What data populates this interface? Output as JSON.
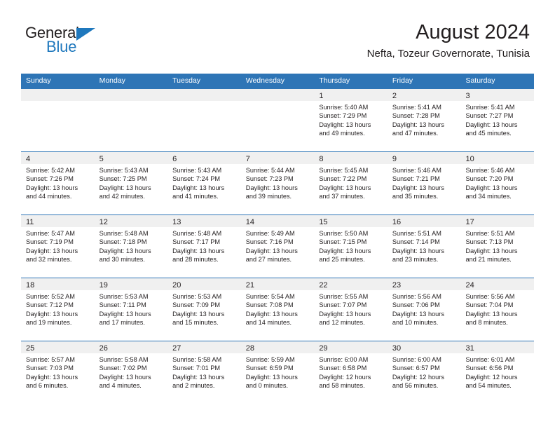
{
  "brand": {
    "name_top": "General",
    "name_bottom": "Blue",
    "accent_color": "#1f78bd"
  },
  "header": {
    "title": "August 2024",
    "subtitle": "Nefta, Tozeur Governorate, Tunisia"
  },
  "theme": {
    "header_row_bg": "#2e75b6",
    "daynum_band_bg": "#f0f0f0",
    "grid_line": "#2e75b6",
    "text": "#231f20"
  },
  "weekdays": [
    "Sunday",
    "Monday",
    "Tuesday",
    "Wednesday",
    "Thursday",
    "Friday",
    "Saturday"
  ],
  "weeks": [
    [
      {
        "day": "",
        "sunrise": "",
        "sunset": "",
        "daylight_1": "",
        "daylight_2": ""
      },
      {
        "day": "",
        "sunrise": "",
        "sunset": "",
        "daylight_1": "",
        "daylight_2": ""
      },
      {
        "day": "",
        "sunrise": "",
        "sunset": "",
        "daylight_1": "",
        "daylight_2": ""
      },
      {
        "day": "",
        "sunrise": "",
        "sunset": "",
        "daylight_1": "",
        "daylight_2": ""
      },
      {
        "day": "1",
        "sunrise": "Sunrise: 5:40 AM",
        "sunset": "Sunset: 7:29 PM",
        "daylight_1": "Daylight: 13 hours",
        "daylight_2": "and 49 minutes."
      },
      {
        "day": "2",
        "sunrise": "Sunrise: 5:41 AM",
        "sunset": "Sunset: 7:28 PM",
        "daylight_1": "Daylight: 13 hours",
        "daylight_2": "and 47 minutes."
      },
      {
        "day": "3",
        "sunrise": "Sunrise: 5:41 AM",
        "sunset": "Sunset: 7:27 PM",
        "daylight_1": "Daylight: 13 hours",
        "daylight_2": "and 45 minutes."
      }
    ],
    [
      {
        "day": "4",
        "sunrise": "Sunrise: 5:42 AM",
        "sunset": "Sunset: 7:26 PM",
        "daylight_1": "Daylight: 13 hours",
        "daylight_2": "and 44 minutes."
      },
      {
        "day": "5",
        "sunrise": "Sunrise: 5:43 AM",
        "sunset": "Sunset: 7:25 PM",
        "daylight_1": "Daylight: 13 hours",
        "daylight_2": "and 42 minutes."
      },
      {
        "day": "6",
        "sunrise": "Sunrise: 5:43 AM",
        "sunset": "Sunset: 7:24 PM",
        "daylight_1": "Daylight: 13 hours",
        "daylight_2": "and 41 minutes."
      },
      {
        "day": "7",
        "sunrise": "Sunrise: 5:44 AM",
        "sunset": "Sunset: 7:23 PM",
        "daylight_1": "Daylight: 13 hours",
        "daylight_2": "and 39 minutes."
      },
      {
        "day": "8",
        "sunrise": "Sunrise: 5:45 AM",
        "sunset": "Sunset: 7:22 PM",
        "daylight_1": "Daylight: 13 hours",
        "daylight_2": "and 37 minutes."
      },
      {
        "day": "9",
        "sunrise": "Sunrise: 5:46 AM",
        "sunset": "Sunset: 7:21 PM",
        "daylight_1": "Daylight: 13 hours",
        "daylight_2": "and 35 minutes."
      },
      {
        "day": "10",
        "sunrise": "Sunrise: 5:46 AM",
        "sunset": "Sunset: 7:20 PM",
        "daylight_1": "Daylight: 13 hours",
        "daylight_2": "and 34 minutes."
      }
    ],
    [
      {
        "day": "11",
        "sunrise": "Sunrise: 5:47 AM",
        "sunset": "Sunset: 7:19 PM",
        "daylight_1": "Daylight: 13 hours",
        "daylight_2": "and 32 minutes."
      },
      {
        "day": "12",
        "sunrise": "Sunrise: 5:48 AM",
        "sunset": "Sunset: 7:18 PM",
        "daylight_1": "Daylight: 13 hours",
        "daylight_2": "and 30 minutes."
      },
      {
        "day": "13",
        "sunrise": "Sunrise: 5:48 AM",
        "sunset": "Sunset: 7:17 PM",
        "daylight_1": "Daylight: 13 hours",
        "daylight_2": "and 28 minutes."
      },
      {
        "day": "14",
        "sunrise": "Sunrise: 5:49 AM",
        "sunset": "Sunset: 7:16 PM",
        "daylight_1": "Daylight: 13 hours",
        "daylight_2": "and 27 minutes."
      },
      {
        "day": "15",
        "sunrise": "Sunrise: 5:50 AM",
        "sunset": "Sunset: 7:15 PM",
        "daylight_1": "Daylight: 13 hours",
        "daylight_2": "and 25 minutes."
      },
      {
        "day": "16",
        "sunrise": "Sunrise: 5:51 AM",
        "sunset": "Sunset: 7:14 PM",
        "daylight_1": "Daylight: 13 hours",
        "daylight_2": "and 23 minutes."
      },
      {
        "day": "17",
        "sunrise": "Sunrise: 5:51 AM",
        "sunset": "Sunset: 7:13 PM",
        "daylight_1": "Daylight: 13 hours",
        "daylight_2": "and 21 minutes."
      }
    ],
    [
      {
        "day": "18",
        "sunrise": "Sunrise: 5:52 AM",
        "sunset": "Sunset: 7:12 PM",
        "daylight_1": "Daylight: 13 hours",
        "daylight_2": "and 19 minutes."
      },
      {
        "day": "19",
        "sunrise": "Sunrise: 5:53 AM",
        "sunset": "Sunset: 7:11 PM",
        "daylight_1": "Daylight: 13 hours",
        "daylight_2": "and 17 minutes."
      },
      {
        "day": "20",
        "sunrise": "Sunrise: 5:53 AM",
        "sunset": "Sunset: 7:09 PM",
        "daylight_1": "Daylight: 13 hours",
        "daylight_2": "and 15 minutes."
      },
      {
        "day": "21",
        "sunrise": "Sunrise: 5:54 AM",
        "sunset": "Sunset: 7:08 PM",
        "daylight_1": "Daylight: 13 hours",
        "daylight_2": "and 14 minutes."
      },
      {
        "day": "22",
        "sunrise": "Sunrise: 5:55 AM",
        "sunset": "Sunset: 7:07 PM",
        "daylight_1": "Daylight: 13 hours",
        "daylight_2": "and 12 minutes."
      },
      {
        "day": "23",
        "sunrise": "Sunrise: 5:56 AM",
        "sunset": "Sunset: 7:06 PM",
        "daylight_1": "Daylight: 13 hours",
        "daylight_2": "and 10 minutes."
      },
      {
        "day": "24",
        "sunrise": "Sunrise: 5:56 AM",
        "sunset": "Sunset: 7:04 PM",
        "daylight_1": "Daylight: 13 hours",
        "daylight_2": "and 8 minutes."
      }
    ],
    [
      {
        "day": "25",
        "sunrise": "Sunrise: 5:57 AM",
        "sunset": "Sunset: 7:03 PM",
        "daylight_1": "Daylight: 13 hours",
        "daylight_2": "and 6 minutes."
      },
      {
        "day": "26",
        "sunrise": "Sunrise: 5:58 AM",
        "sunset": "Sunset: 7:02 PM",
        "daylight_1": "Daylight: 13 hours",
        "daylight_2": "and 4 minutes."
      },
      {
        "day": "27",
        "sunrise": "Sunrise: 5:58 AM",
        "sunset": "Sunset: 7:01 PM",
        "daylight_1": "Daylight: 13 hours",
        "daylight_2": "and 2 minutes."
      },
      {
        "day": "28",
        "sunrise": "Sunrise: 5:59 AM",
        "sunset": "Sunset: 6:59 PM",
        "daylight_1": "Daylight: 13 hours",
        "daylight_2": "and 0 minutes."
      },
      {
        "day": "29",
        "sunrise": "Sunrise: 6:00 AM",
        "sunset": "Sunset: 6:58 PM",
        "daylight_1": "Daylight: 12 hours",
        "daylight_2": "and 58 minutes."
      },
      {
        "day": "30",
        "sunrise": "Sunrise: 6:00 AM",
        "sunset": "Sunset: 6:57 PM",
        "daylight_1": "Daylight: 12 hours",
        "daylight_2": "and 56 minutes."
      },
      {
        "day": "31",
        "sunrise": "Sunrise: 6:01 AM",
        "sunset": "Sunset: 6:56 PM",
        "daylight_1": "Daylight: 12 hours",
        "daylight_2": "and 54 minutes."
      }
    ]
  ]
}
